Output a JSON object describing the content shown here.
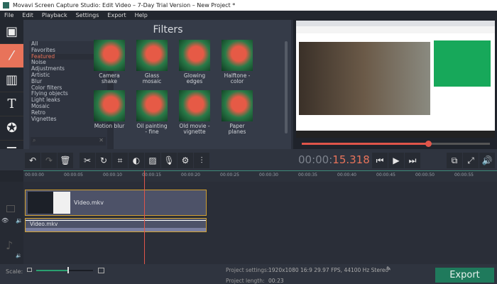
{
  "window": {
    "title": "Movavi Screen Capture Studio: Edit Video – 7-Day Trial Version – New Project *"
  },
  "menu": [
    "File",
    "Edit",
    "Playback",
    "Settings",
    "Export",
    "Help"
  ],
  "sidebar": [
    {
      "icon": "film-icon"
    },
    {
      "icon": "magic-wand-icon",
      "active": true
    },
    {
      "icon": "transitions-icon"
    },
    {
      "icon": "text-icon"
    },
    {
      "icon": "sticker-star-icon"
    },
    {
      "icon": "menu-icon"
    }
  ],
  "filters": {
    "title": "Filters",
    "categories": [
      "All",
      "Favorites",
      "Featured",
      "Noise",
      "Adjustments",
      "Artistic",
      "Blur",
      "Color filters",
      "Flying objects",
      "Light leaks",
      "Mosaic",
      "Retro",
      "Vignettes"
    ],
    "selected": "Featured",
    "tiles": [
      "Camera shake",
      "Glass mosaic",
      "Glowing edges",
      "Halftone - color",
      "Motion blur",
      "Oil painting - fine",
      "Old movie - vignette",
      "Paper planes"
    ]
  },
  "player": {
    "time_prefix": "00:00:",
    "time_value": "15.318",
    "progress": 0.67
  },
  "timeline": {
    "ticks": [
      "00:00:00",
      "00:00:05",
      "00:00:10",
      "00:00:15",
      "00:00:20",
      "00:00:25",
      "00:00:30",
      "00:00:35",
      "00:00:40",
      "00:00:45",
      "00:00:50",
      "00:00:55"
    ],
    "video_clip": "Video.mkv",
    "audio_clip": "Video.mkv"
  },
  "bottom": {
    "scale_label": "Scale:",
    "scale_value": 0.55,
    "settings_label": "Project settings:",
    "settings_value": "1920x1080 16:9 29.97 FPS, 44100 Hz Stereo",
    "length_label": "Project length:",
    "length_value": "00:23",
    "export_label": "Export"
  },
  "colors": {
    "accent": "#e8735a",
    "export": "#1f7a5c"
  }
}
